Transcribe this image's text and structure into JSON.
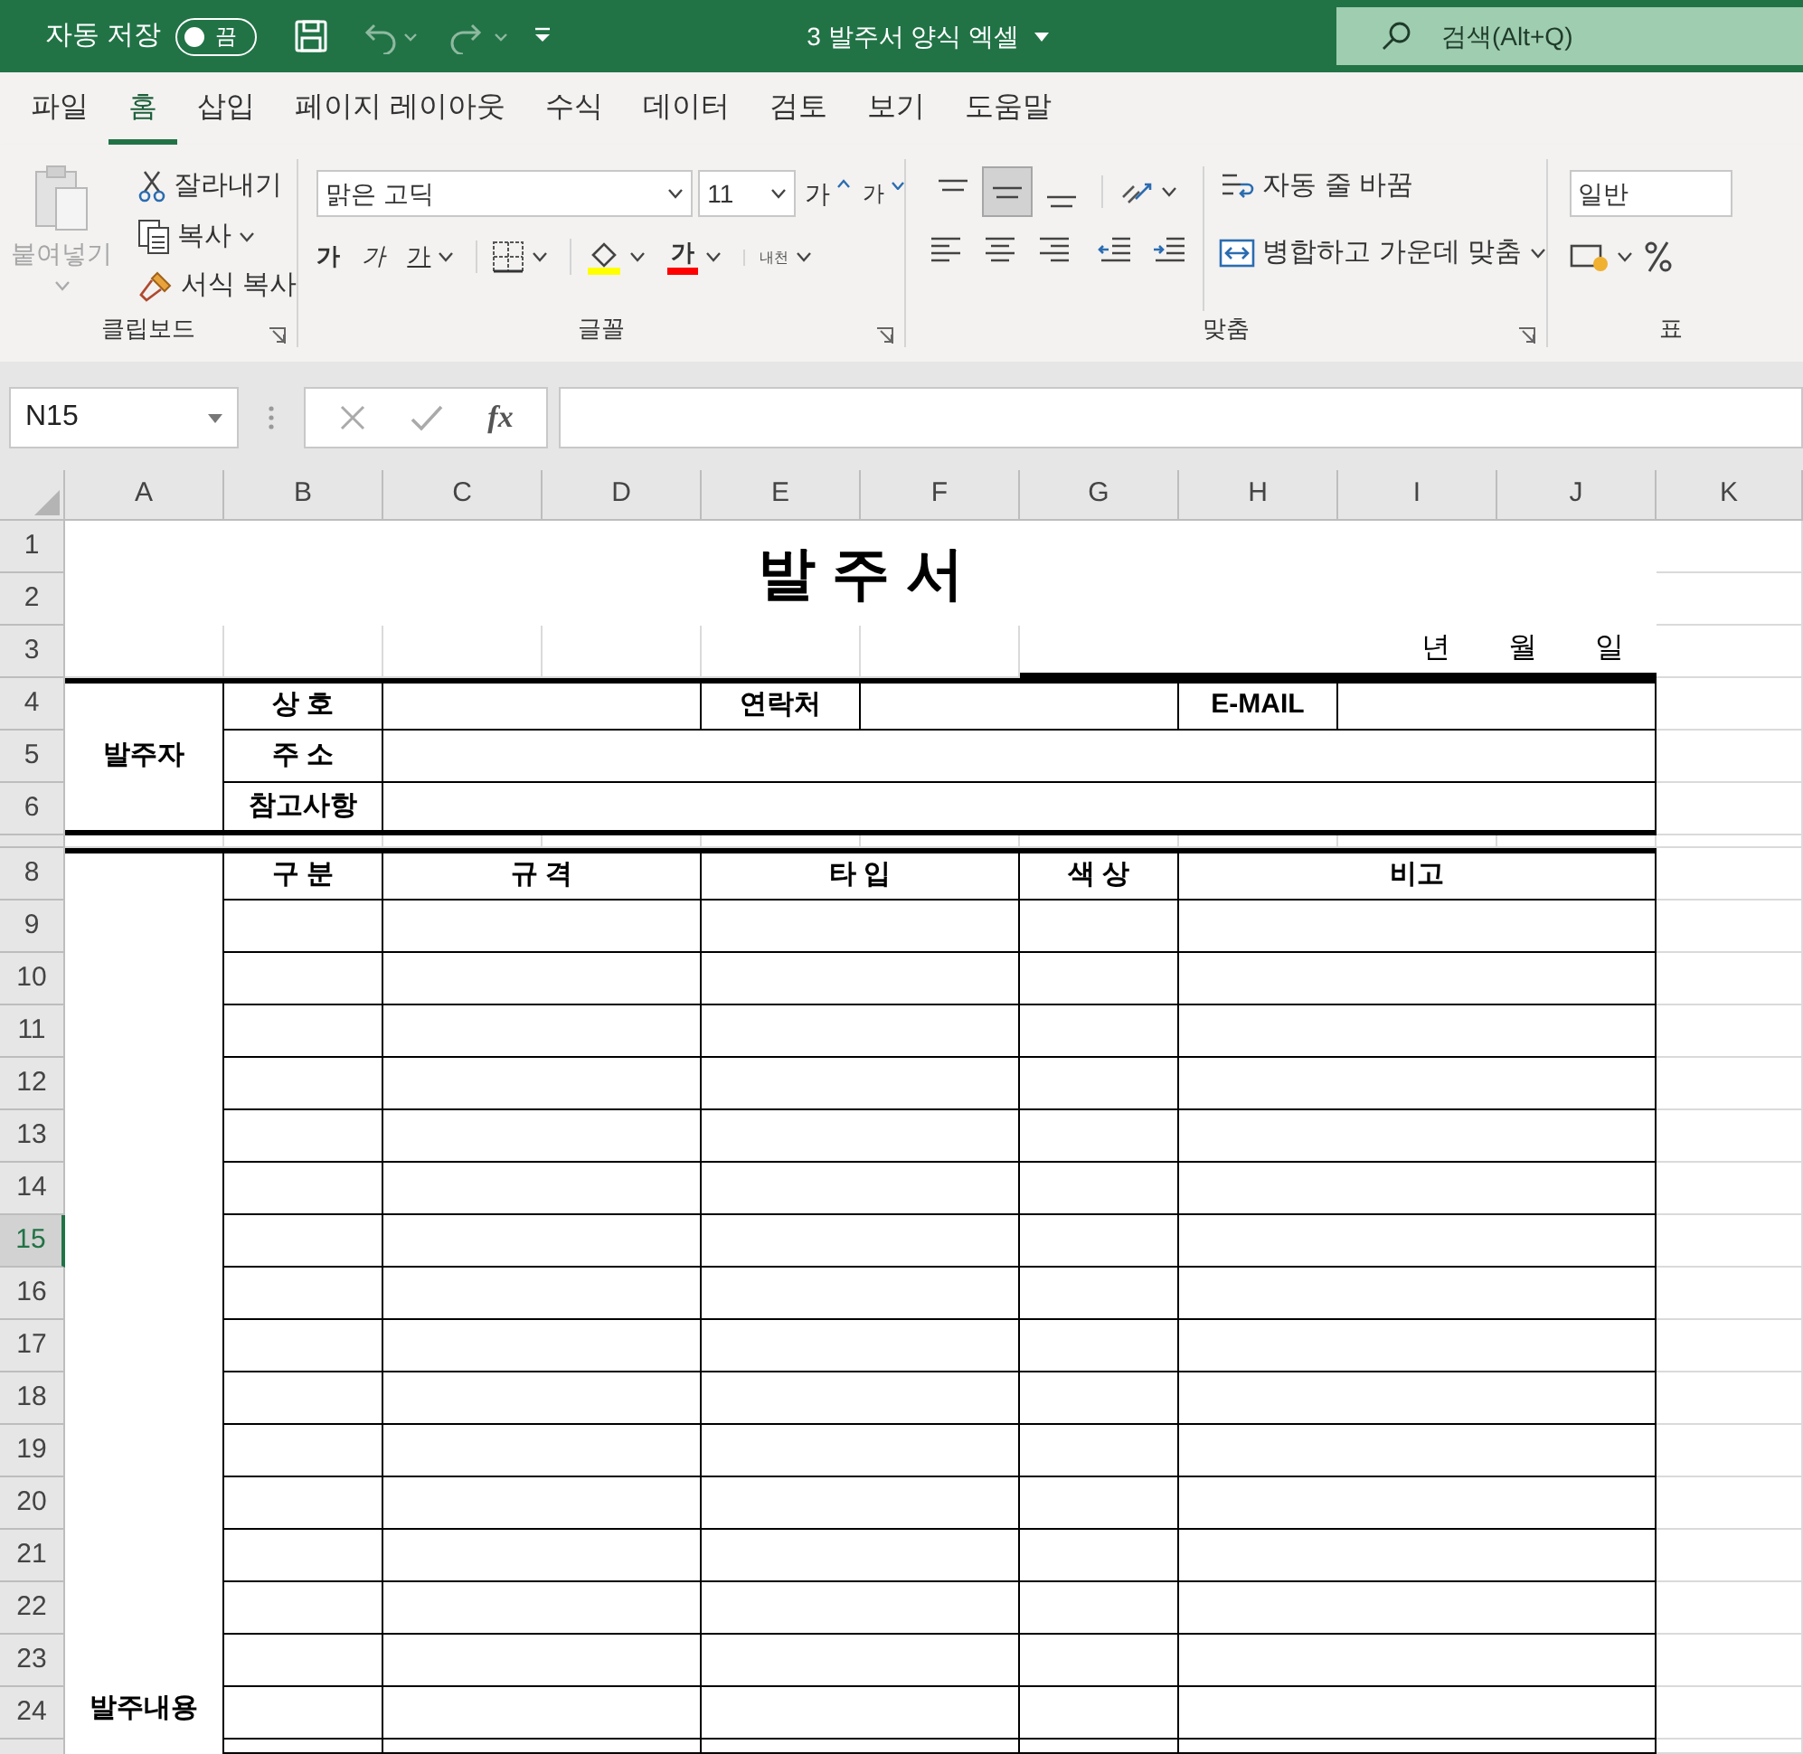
{
  "title_bar": {
    "autosave_label": "자동 저장",
    "autosave": {
      "on": false,
      "label": "끔"
    },
    "title": "3 발주서 양식 엑셀",
    "search_placeholder": "검색(Alt+Q)"
  },
  "tabs": [
    {
      "label": "파일",
      "selected": false
    },
    {
      "label": "홈",
      "selected": true
    },
    {
      "label": "삽입",
      "selected": false
    },
    {
      "label": "페이지 레이아웃",
      "selected": false
    },
    {
      "label": "수식",
      "selected": false
    },
    {
      "label": "데이터",
      "selected": false
    },
    {
      "label": "검토",
      "selected": false
    },
    {
      "label": "보기",
      "selected": false
    },
    {
      "label": "도움말",
      "selected": false
    }
  ],
  "ribbon": {
    "clipboard": {
      "paste": {
        "label": "붙여넣기",
        "disabled": true
      },
      "cut": "잘라내기",
      "copy": "복사",
      "format_painter": "서식 복사",
      "group_label": "클립보드"
    },
    "font": {
      "font_name": "맑은 고딕",
      "font_size": "11",
      "grow": "가",
      "shrink": "가",
      "bold": "가",
      "italic": "가",
      "underline": "가",
      "font_color": "가",
      "phonetic": "내천",
      "group_label": "글꼴"
    },
    "alignment": {
      "vertical_align": [
        {
          "selected": false
        },
        {
          "selected": true
        },
        {
          "selected": false
        }
      ],
      "wrap_text": "자동 줄 바꿈",
      "merge_center": "병합하고 가운데 맞춤",
      "group_label": "맞춤"
    },
    "number": {
      "format": "일반",
      "group_label": "표"
    }
  },
  "formula_bar": {
    "name_box": "N15",
    "fx": "fx"
  },
  "sheet": {
    "columns": [
      "A",
      "B",
      "C",
      "D",
      "E",
      "F",
      "G",
      "H",
      "I",
      "J",
      "K"
    ],
    "rows": [
      {
        "kind": "normal",
        "label": "1",
        "selected": false
      },
      {
        "kind": "normal",
        "label": "2",
        "selected": false
      },
      {
        "kind": "normal",
        "label": "3",
        "selected": false
      },
      {
        "kind": "normal",
        "label": "4",
        "selected": false
      },
      {
        "kind": "normal",
        "label": "5",
        "selected": false
      },
      {
        "kind": "normal",
        "label": "6",
        "selected": false
      },
      {
        "kind": "collapsed",
        "selected": false
      },
      {
        "kind": "normal",
        "label": "8",
        "selected": false
      },
      {
        "kind": "normal",
        "label": "9",
        "selected": false
      },
      {
        "kind": "normal",
        "label": "10",
        "selected": false
      },
      {
        "kind": "normal",
        "label": "11",
        "selected": false
      },
      {
        "kind": "normal",
        "label": "12",
        "selected": false
      },
      {
        "kind": "normal",
        "label": "13",
        "selected": false
      },
      {
        "kind": "normal",
        "label": "14",
        "selected": false
      },
      {
        "kind": "normal",
        "label": "15",
        "selected": true
      },
      {
        "kind": "normal",
        "label": "16",
        "selected": false
      },
      {
        "kind": "normal",
        "label": "17",
        "selected": false
      },
      {
        "kind": "normal",
        "label": "18",
        "selected": false
      },
      {
        "kind": "normal",
        "label": "19",
        "selected": false
      },
      {
        "kind": "normal",
        "label": "20",
        "selected": false
      },
      {
        "kind": "normal",
        "label": "21",
        "selected": false
      },
      {
        "kind": "normal",
        "label": "22",
        "selected": false
      },
      {
        "kind": "normal",
        "label": "23",
        "selected": false
      },
      {
        "kind": "normal",
        "label": "24",
        "selected": false
      }
    ],
    "form": {
      "title": "발 주 서",
      "date": [
        "년",
        "월",
        "일"
      ],
      "orderer": "발주자",
      "company": "상 호",
      "contact": "연락처",
      "email": "E-MAIL",
      "address": "주 소",
      "notes": "참고사항",
      "order_details": "발주내용",
      "headers": [
        "구 분",
        "규 격",
        "타 입",
        "색 상",
        "비고"
      ]
    }
  }
}
